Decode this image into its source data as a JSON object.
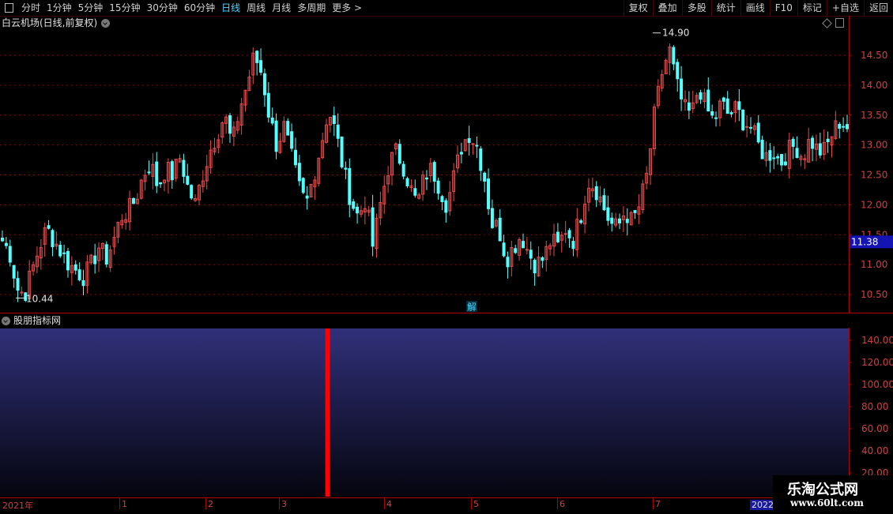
{
  "toolbar": {
    "periods": [
      "分时",
      "1分钟",
      "5分钟",
      "15分钟",
      "30分钟",
      "60分钟",
      "日线",
      "周线",
      "月线",
      "多周期",
      "更多 >"
    ],
    "active_period": "日线",
    "right_buttons": [
      "复权",
      "叠加",
      "多股",
      "统计",
      "画线",
      "F10",
      "标记",
      "+自选",
      "返回"
    ]
  },
  "chart_title": "白云机场(日线,前复权)",
  "indicator_title": "股朋指标网",
  "current_price_label": "11.38",
  "max_label": "14.90",
  "min_label": "10.44",
  "jie_label": "解",
  "price_axis_labels": [
    "14.50",
    "14.00",
    "13.50",
    "13.00",
    "12.50",
    "12.00",
    "11.50",
    "11.00",
    "10.50"
  ],
  "indicator_axis_labels": [
    "140.00",
    "120.00",
    "100.00",
    "80.00",
    "60.00",
    "40.00",
    "20.00"
  ],
  "date_labels": [
    "2021年",
    "1",
    "2",
    "3",
    "4",
    "5",
    "6",
    "7"
  ],
  "year_2022": "2022",
  "watermark": {
    "line1": "乐淘公式网",
    "line2": "www.60lt.com"
  },
  "colors": {
    "up": "#e84a4a",
    "down": "#54ffff",
    "grid": "#8b0000",
    "indicator_top": "#30307a",
    "indicator_spike": "#ff0000"
  },
  "chart_data": {
    "type": "candlestick",
    "title": "白云机场(日线,前复权)",
    "ylim": [
      10.3,
      14.9
    ],
    "y_ticks": [
      10.5,
      11.0,
      11.5,
      12.0,
      12.5,
      13.0,
      13.5,
      14.0,
      14.5
    ],
    "max_price": 14.9,
    "min_price": 10.44,
    "last_price": 11.38,
    "close_path": [
      11.4,
      11.2,
      10.6,
      10.5,
      10.9,
      11.3,
      11.6,
      11.4,
      11.2,
      11.0,
      10.9,
      10.8,
      11.0,
      11.3,
      11.1,
      11.4,
      11.8,
      11.9,
      12.1,
      12.5,
      12.7,
      12.3,
      12.6,
      12.5,
      12.8,
      12.3,
      12.0,
      12.5,
      12.9,
      13.2,
      13.5,
      13.0,
      13.6,
      14.0,
      14.5,
      14.2,
      13.5,
      13.0,
      13.3,
      12.8,
      12.3,
      12.0,
      12.5,
      13.0,
      13.6,
      13.2,
      12.6,
      12.1,
      11.8,
      12.1,
      11.3,
      12.0,
      12.6,
      12.9,
      12.7,
      12.3,
      12.0,
      12.5,
      12.6,
      12.3,
      12.0,
      12.5,
      13.0,
      13.2,
      13.0,
      12.5,
      11.7,
      11.6,
      11.1,
      11.3,
      11.5,
      11.2,
      11.0,
      11.1,
      11.4,
      11.3,
      11.6,
      11.4,
      11.8,
      12.4,
      12.3,
      12.0,
      11.7,
      11.6,
      11.9,
      11.7,
      12.0,
      12.5,
      13.5,
      14.2,
      14.6,
      14.0,
      13.6,
      13.5,
      14.0,
      13.6,
      13.4,
      13.7,
      13.5,
      13.6,
      13.4,
      13.3,
      13.0,
      12.8,
      12.9,
      12.7,
      12.9,
      13.0,
      12.8,
      13.1,
      12.9,
      12.9,
      13.2,
      13.4,
      13.3
    ],
    "bars": 220,
    "indicator": {
      "type": "area",
      "ylim": [
        0,
        150
      ],
      "value": 150,
      "spike_position": 0.386
    }
  }
}
